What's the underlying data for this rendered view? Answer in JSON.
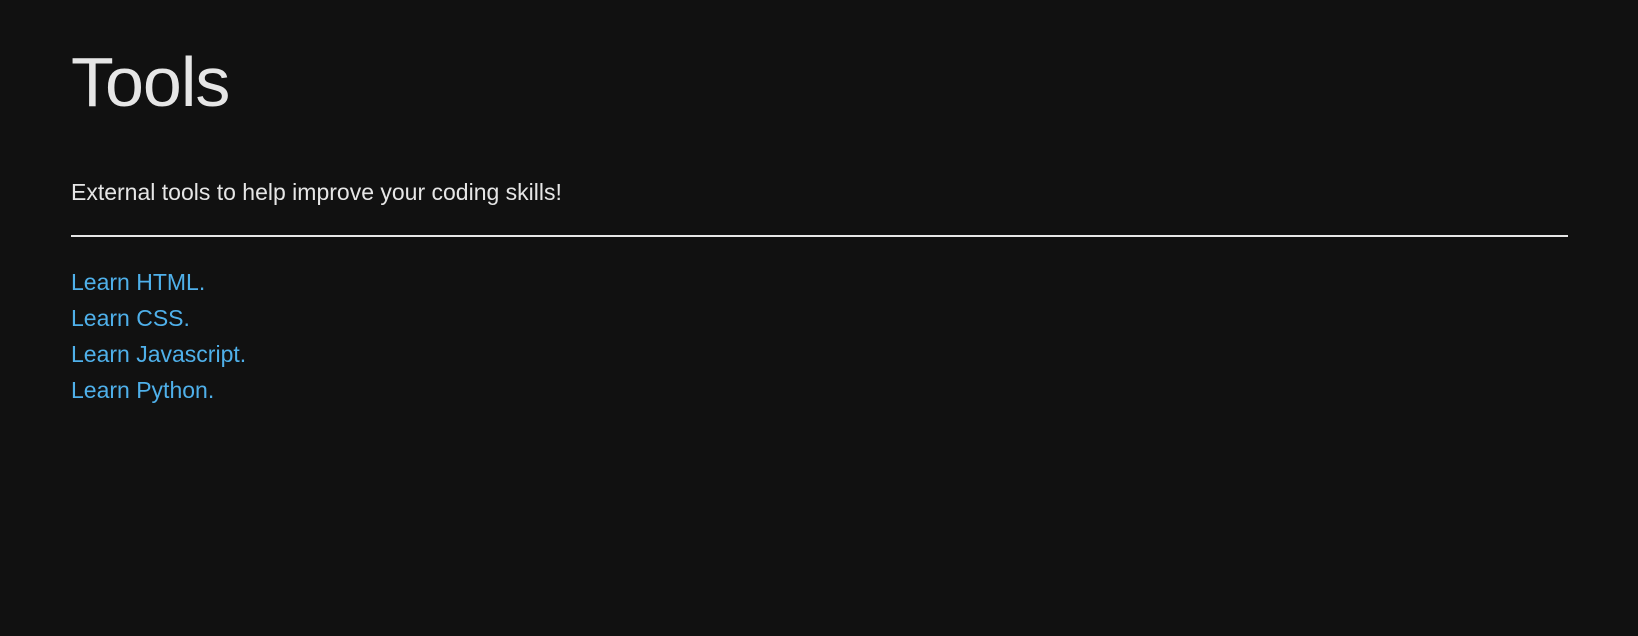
{
  "page": {
    "title": "Tools",
    "subtitle": "External tools to help improve your coding skills!"
  },
  "links": [
    {
      "label": "Learn HTML."
    },
    {
      "label": "Learn CSS."
    },
    {
      "label": "Learn Javascript."
    },
    {
      "label": "Learn Python."
    }
  ],
  "colors": {
    "background": "#111111",
    "text": "#e6e6e6",
    "link": "#4fb0ea"
  }
}
